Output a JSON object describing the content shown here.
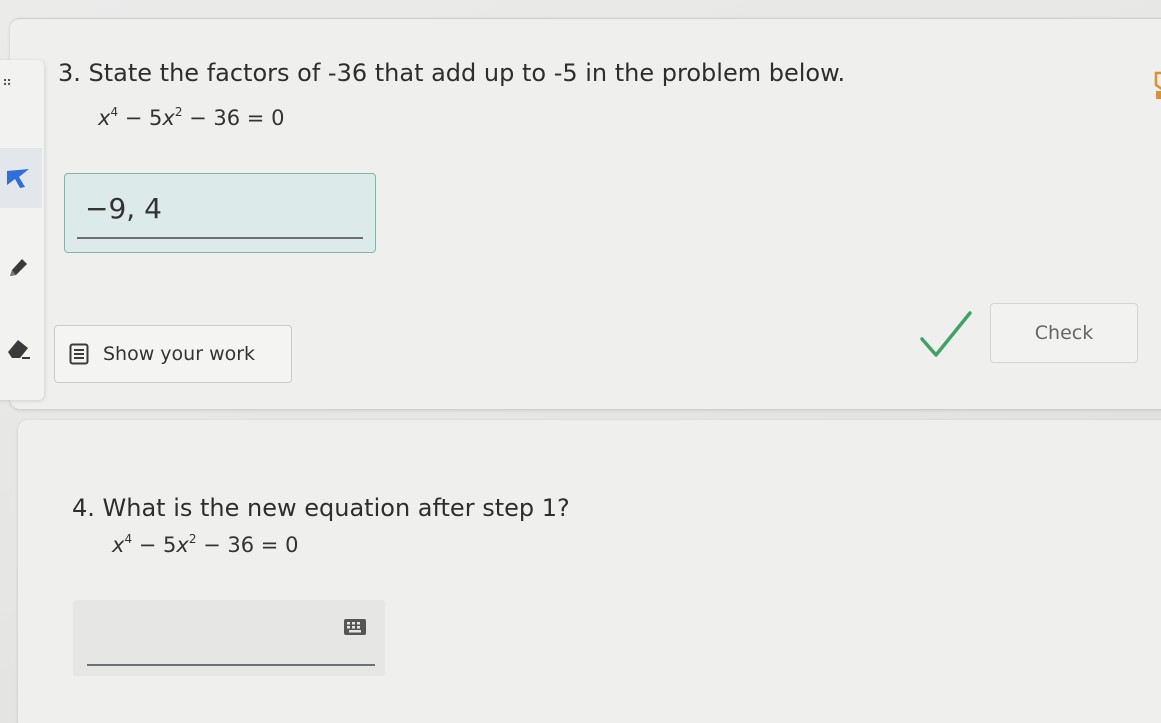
{
  "question3": {
    "prompt": "3. State the factors of -36 that add up to -5 in the problem below.",
    "equation": {
      "var1": "x",
      "exp1": "4",
      "mid": " − 5",
      "var2": "x",
      "exp2": "2",
      "rest": " − 36 = 0"
    },
    "answer_value": "−9, 4",
    "show_work_label": "Show your work",
    "check_label": "Check"
  },
  "question4": {
    "prompt": "4. What is the new equation after step 1?",
    "equation": {
      "var1": "x",
      "exp1": "4",
      "mid": " − 5",
      "var2": "x",
      "exp2": "2",
      "rest": " − 36 = 0"
    },
    "answer_value": ""
  },
  "toolbar": {
    "handle": "⠶",
    "tools": [
      "drag-handle-icon",
      "pointer-icon",
      "pencil-icon",
      "eraser-icon"
    ]
  },
  "colors": {
    "accent_blue": "#2f6fdb",
    "correct_green": "#3fa463",
    "answer_bg": "#dcebe9",
    "answer_border": "#7fb7a9"
  }
}
